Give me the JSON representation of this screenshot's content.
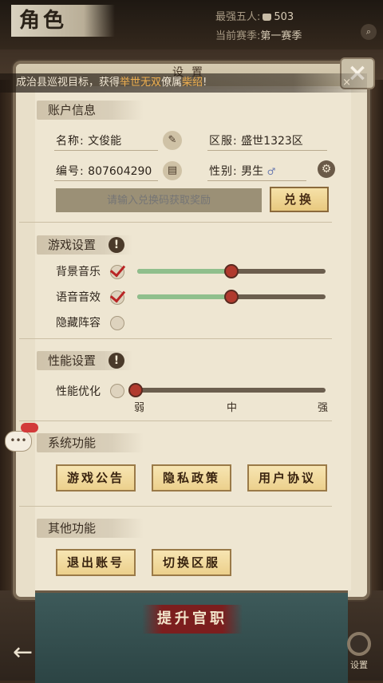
{
  "header": {
    "title": "角色",
    "strongest_label": "最强五人:",
    "strongest_value": "503",
    "season_label": "当前赛季:",
    "season_value": "第一赛季"
  },
  "notice": {
    "prefix": "成治县巡视目标，获得",
    "highlight1": "举世无双",
    "middle": "僚属",
    "highlight2": "柴绍",
    "suffix": "!",
    "close": "×"
  },
  "dialog": {
    "title": "设置",
    "close": "×"
  },
  "account": {
    "section": "账户信息",
    "name_label": "名称:",
    "name_value": "文俊能",
    "server_label": "区服:",
    "server_value": "盛世1323区",
    "id_label": "编号:",
    "id_value": "807604290",
    "gender_label": "性别:",
    "gender_value": "男生",
    "redeem_placeholder": "请输入兑换码获取奖励",
    "redeem_button": "兑换"
  },
  "game_settings": {
    "section": "游戏设置",
    "help": "!",
    "bgm_label": "背景音乐",
    "bgm_on": true,
    "bgm_level": 0.5,
    "sfx_label": "语音音效",
    "sfx_on": true,
    "sfx_level": 0.5,
    "hide_lineup_label": "隐藏阵容",
    "hide_lineup_on": false
  },
  "performance": {
    "section": "性能设置",
    "help": "!",
    "optimize_label": "性能优化",
    "optimize_on": false,
    "level_low": "弱",
    "level_mid": "中",
    "level_high": "强",
    "level": 0.0
  },
  "system": {
    "section": "系统功能",
    "announcement": "游戏公告",
    "privacy": "隐私政策",
    "agreement": "用户协议"
  },
  "other": {
    "section": "其他功能",
    "logout": "退出账号",
    "switch_server": "切换区服"
  },
  "footer": {
    "promote": "提升官职",
    "settings": "设置"
  },
  "icons": {
    "edit": "brush-icon",
    "copy": "scroll-icon",
    "gender": "gender-icon",
    "gender_settings": "gear-icon",
    "back": "back-arrow-icon",
    "search": "search-icon",
    "chat": "chat-icon"
  },
  "colors": {
    "highlight": "#f0b050",
    "slider_fill": "#8fbf8c",
    "knob": "#b13a2e",
    "check": "#b92525"
  }
}
